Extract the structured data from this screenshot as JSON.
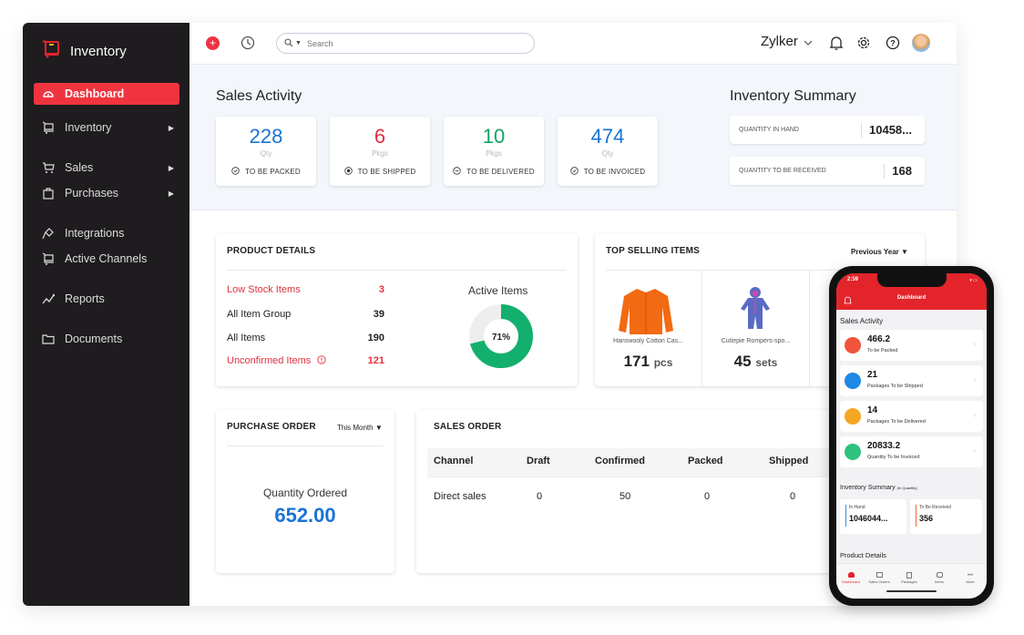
{
  "app": {
    "name": "Inventory"
  },
  "sidebar": {
    "items": [
      {
        "label": "Dashboard",
        "icon": "dashboard-icon",
        "active": true,
        "submenu": false
      },
      {
        "label": "Inventory",
        "icon": "inventory-icon",
        "submenu": true
      },
      {
        "label": "Sales",
        "icon": "cart-icon",
        "submenu": true
      },
      {
        "label": "Purchases",
        "icon": "bag-icon",
        "submenu": true
      },
      {
        "label": "Integrations",
        "icon": "plug-icon",
        "submenu": false
      },
      {
        "label": "Active Channels",
        "icon": "channels-icon",
        "submenu": false
      },
      {
        "label": "Reports",
        "icon": "reports-icon",
        "submenu": false
      },
      {
        "label": "Documents",
        "icon": "folder-icon",
        "submenu": false
      }
    ]
  },
  "topbar": {
    "search_placeholder": "Search",
    "org_name": "Zylker"
  },
  "sales_activity": {
    "title": "Sales Activity",
    "cards": [
      {
        "value": "228",
        "unit": "Qty",
        "label": "TO BE PACKED",
        "color": "#1a73d4"
      },
      {
        "value": "6",
        "unit": "Pkgs",
        "label": "TO BE SHIPPED",
        "color": "#e0313f"
      },
      {
        "value": "10",
        "unit": "Pkgs",
        "label": "TO BE DELIVERED",
        "color": "#12a366"
      },
      {
        "value": "474",
        "unit": "Qty",
        "label": "TO BE INVOICED",
        "color": "#1a73d4"
      }
    ]
  },
  "inventory_summary": {
    "title": "Inventory Summary",
    "rows": [
      {
        "label": "QUANTITY IN HAND",
        "value": "10458..."
      },
      {
        "label": "QUANTITY TO BE RECEIVED",
        "value": "168"
      }
    ]
  },
  "product_details": {
    "title": "PRODUCT DETAILS",
    "rows": [
      {
        "label": "Low Stock Items",
        "value": "3",
        "alert": true
      },
      {
        "label": "All Item Group",
        "value": "39",
        "alert": false
      },
      {
        "label": "All Items",
        "value": "190",
        "alert": false
      },
      {
        "label": "Unconfirmed Items",
        "value": "121",
        "alert": true
      }
    ],
    "active_items": {
      "title": "Active Items",
      "percent": 71,
      "label": "71%"
    }
  },
  "top_selling": {
    "title": "TOP SELLING ITEMS",
    "period": "Previous Year",
    "items": [
      {
        "name": "Hanswooly Cotton Cas...",
        "qty": "171",
        "unit": "pcs"
      },
      {
        "name": "Cutiepie Rompers-spo...",
        "qty": "45",
        "unit": "sets"
      }
    ]
  },
  "purchase_order": {
    "title": "PURCHASE ORDER",
    "period": "This Month",
    "label": "Quantity Ordered",
    "value": "652.00"
  },
  "sales_order": {
    "title": "SALES ORDER",
    "columns": [
      "Channel",
      "Draft",
      "Confirmed",
      "Packed",
      "Shipped"
    ],
    "rows": [
      [
        "Direct sales",
        "0",
        "50",
        "0",
        "0"
      ]
    ]
  },
  "mobile": {
    "time": "2:59",
    "title": "Dashboard",
    "sales_activity_title": "Sales Activity",
    "cards": [
      {
        "value": "466.2",
        "label": "To be Packed",
        "color": "#f0543a"
      },
      {
        "value": "21",
        "label": "Packages To be Shipped",
        "color": "#1e88e5"
      },
      {
        "value": "14",
        "label": "Packages To be Delivered",
        "color": "#f5a623"
      },
      {
        "value": "20833.2",
        "label": "Quantity To be Invoiced",
        "color": "#2ec27e"
      }
    ],
    "inventory_summary_title": "Inventory Summary",
    "inventory_summary_sub": "(In Quantity)",
    "in_hand_label": "In Hand",
    "in_hand_value": "1046044...",
    "to_receive_label": "To Be Received",
    "to_receive_value": "356",
    "product_details_title": "Product Details",
    "tabs": [
      "Dashboard",
      "Sales Orders",
      "Packages",
      "Items",
      "More"
    ]
  }
}
